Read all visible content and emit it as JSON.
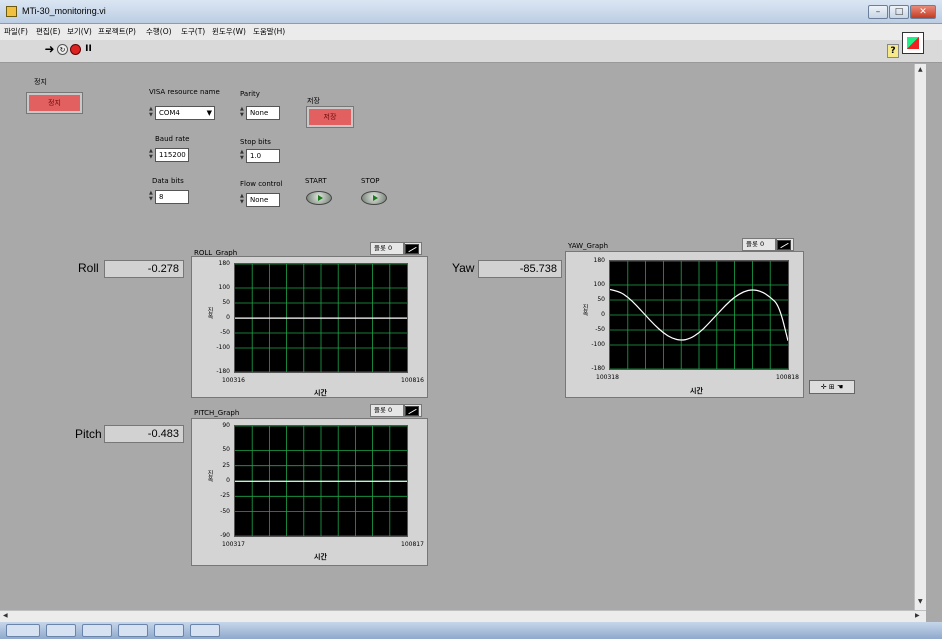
{
  "window": {
    "title": "MTi-30_monitoring.vi"
  },
  "menu": [
    "파일(F)",
    "편집(E)",
    "보기(V)",
    "프로젝트(P)",
    "수행(O)",
    "도구(T)",
    "윈도우(W)",
    "도움말(H)"
  ],
  "toolbar": {
    "help": "?"
  },
  "controls": {
    "stop_label": "정지",
    "stop_button": "정지",
    "visa_label": "VISA resource name",
    "visa_value": "COM4",
    "baud_label": "Baud rate",
    "baud_value": "115200",
    "databits_label": "Data bits",
    "databits_value": "8",
    "parity_label": "Parity",
    "parity_value": "None",
    "stopbits_label": "Stop bits",
    "stopbits_value": "1.0",
    "flow_label": "Flow control",
    "flow_value": "None",
    "save_label": "저장",
    "save_button": "저장",
    "start_label": "START",
    "stop2_label": "STOP"
  },
  "indicators": {
    "roll_label": "Roll",
    "roll_value": "-0.278",
    "pitch_label": "Pitch",
    "pitch_value": "-0.483",
    "yaw_label": "Yaw",
    "yaw_value": "-85.738"
  },
  "graphs": {
    "roll": {
      "title": "ROLL_Graph",
      "legend": "플롯 0",
      "yticks": [
        "180",
        "100",
        "50",
        "0",
        "-50",
        "-100",
        "-180"
      ],
      "xmin": "100316",
      "xmax": "100816",
      "xlabel": "시간",
      "ylabel": "진폭"
    },
    "pitch": {
      "title": "PITCH_Graph",
      "legend": "플롯 0",
      "yticks": [
        "90",
        "50",
        "25",
        "0",
        "-25",
        "-50",
        "-90"
      ],
      "xmin": "100317",
      "xmax": "100817",
      "xlabel": "시간",
      "ylabel": "진폭"
    },
    "yaw": {
      "title": "YAW_Graph",
      "legend": "플롯 0",
      "yticks": [
        "180",
        "100",
        "50",
        "0",
        "-50",
        "-100",
        "-180"
      ],
      "xmin": "100318",
      "xmax": "100818",
      "xlabel": "시간",
      "ylabel": "진폭"
    }
  },
  "colors": {
    "plot_bg": "#000000",
    "grid": "#1fa64a",
    "trace": "#ffffff",
    "button_red": "#e26060"
  },
  "chart_data": [
    {
      "type": "line",
      "title": "ROLL_Graph",
      "xlabel": "시간",
      "ylabel": "진폭",
      "xlim": [
        100316,
        100816
      ],
      "ylim": [
        -180,
        180
      ],
      "series": [
        {
          "name": "플롯 0",
          "x": [
            100316,
            100816
          ],
          "y": [
            -0.278,
            -0.278
          ]
        }
      ]
    },
    {
      "type": "line",
      "title": "PITCH_Graph",
      "xlabel": "시간",
      "ylabel": "진폭",
      "xlim": [
        100317,
        100817
      ],
      "ylim": [
        -90,
        90
      ],
      "series": [
        {
          "name": "플롯 0",
          "x": [
            100317,
            100817
          ],
          "y": [
            -0.483,
            -0.483
          ]
        }
      ]
    },
    {
      "type": "line",
      "title": "YAW_Graph",
      "xlabel": "시간",
      "ylabel": "진폭",
      "xlim": [
        100318,
        100818
      ],
      "ylim": [
        -180,
        180
      ],
      "series": [
        {
          "name": "플롯 0",
          "x": [
            100318,
            100343,
            100368,
            100393,
            100418,
            100443,
            100468,
            100493,
            100518,
            100543,
            100568,
            100593,
            100618,
            100643,
            100668,
            100693,
            100718,
            100743,
            100768,
            100793,
            100818
          ],
          "y": [
            85,
            79,
            60,
            31,
            -1,
            -33,
            -60,
            -78,
            -85,
            -79,
            -60,
            -31,
            1,
            33,
            60,
            78,
            85,
            79,
            60,
            31,
            -86
          ]
        }
      ]
    }
  ]
}
